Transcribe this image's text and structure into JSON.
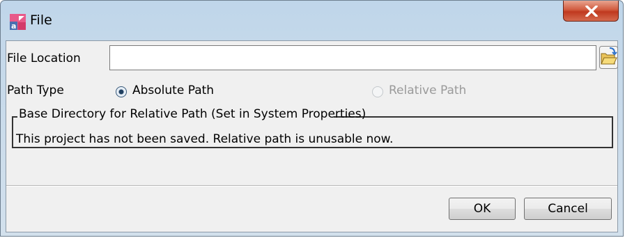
{
  "window": {
    "title": "File",
    "icon": "astah-app-icon",
    "close_icon": "close-x-icon"
  },
  "file_location": {
    "label": "File Location",
    "value": "",
    "browse_icon": "open-folder-icon"
  },
  "path_type": {
    "label": "Path Type",
    "options": [
      {
        "label": "Absolute Path",
        "selected": true,
        "enabled": true
      },
      {
        "label": "Relative Path",
        "selected": false,
        "enabled": false
      }
    ]
  },
  "base_directory": {
    "title": "Base Directory for Relative Path (Set in System Properties)",
    "message": "This project has not been saved. Relative path is unusable now."
  },
  "buttons": {
    "ok": "OK",
    "cancel": "Cancel"
  },
  "colors": {
    "close_button": "#c9472b",
    "disabled_text": "#9a9a9a",
    "dialog_background": "#f0f0f0"
  }
}
